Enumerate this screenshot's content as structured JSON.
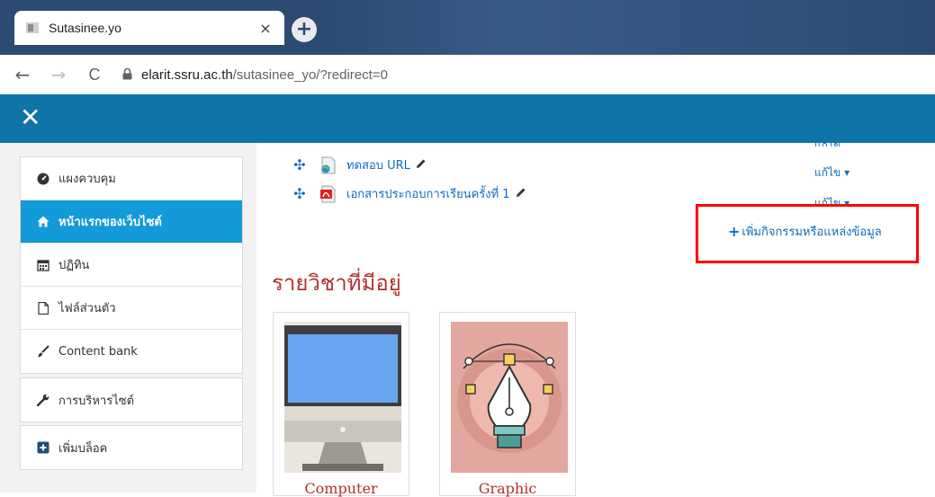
{
  "browser": {
    "tab_title": "Sutasinee.yo",
    "close_glyph": "×",
    "new_tab_glyph": "+",
    "back_glyph": "←",
    "forward_glyph": "→",
    "reload_glyph": "C",
    "url_host": "elarit.ssru.ac.th",
    "url_path": "/sutasinee_yo/?redirect=0"
  },
  "header": {
    "close_glyph": "✕",
    "color": "#0f75a8"
  },
  "sidebar": {
    "items": [
      {
        "label": "แผงควบคุม",
        "icon": "dashboard-icon",
        "active": false
      },
      {
        "label": "หน้าแรกของเว็บไซต์",
        "icon": "home-icon",
        "active": true
      },
      {
        "label": "ปฏิทิน",
        "icon": "calendar-icon",
        "active": false
      },
      {
        "label": "ไฟล์ส่วนตัว",
        "icon": "file-icon",
        "active": false
      },
      {
        "label": "Content bank",
        "icon": "brush-icon",
        "active": false
      },
      {
        "label": "การบริหารไซต์",
        "icon": "wrench-icon",
        "active": false
      },
      {
        "label": "เพิ่มบล็อค",
        "icon": "plus-square-icon",
        "active": false
      }
    ],
    "active_color": "#139ad8"
  },
  "main": {
    "activities": [
      {
        "label": "ทดสอบ URL",
        "icon": "url-icon"
      },
      {
        "label": "เอกสารประกอบการเรียนครั้งที่ 1",
        "icon": "pdf-icon"
      }
    ],
    "edit_label_1": "แก้ไข",
    "edit_label_2": "แก้ไข",
    "edit_label_3": "แก้ไข",
    "edit_caret": "▾",
    "add_activity_label": "เพิ่มกิจกรรมหรือแหล่งข้อมูล",
    "highlight_color": "#ff0000",
    "section_title": "รายวิชาที่มีอยู่",
    "courses": [
      {
        "name": "Computer",
        "image": "computer-monitor-image"
      },
      {
        "name": "Graphic",
        "image": "pen-tool-image"
      }
    ]
  }
}
